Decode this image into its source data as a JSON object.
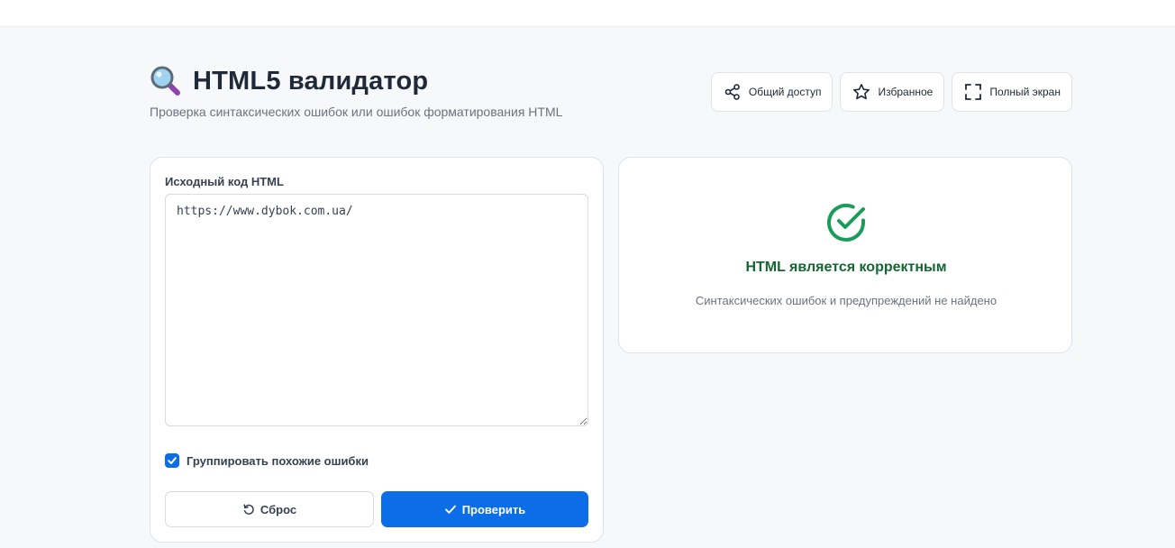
{
  "header": {
    "title": "HTML5 валидатор",
    "subtitle": "Проверка синтаксических ошибок или ошибок форматирования HTML",
    "icon": "magnifier-emoji-icon"
  },
  "actions": {
    "share_label": "Общий доступ",
    "favorite_label": "Избранное",
    "fullscreen_label": "Полный экран"
  },
  "editor": {
    "label": "Исходный код HTML",
    "value": "https://www.dybok.com.ua/",
    "group_errors_label": "Группировать похожие ошибки",
    "group_errors_checked": true,
    "reset_label": "Сброс",
    "check_label": "Проверить"
  },
  "result": {
    "status_title": "HTML является корректным",
    "status_desc": "Синтаксических ошибок и предупреждений не найдено",
    "status_color": "#1a9c5b"
  },
  "colors": {
    "accent": "#0b6ee8",
    "success": "#166534"
  }
}
